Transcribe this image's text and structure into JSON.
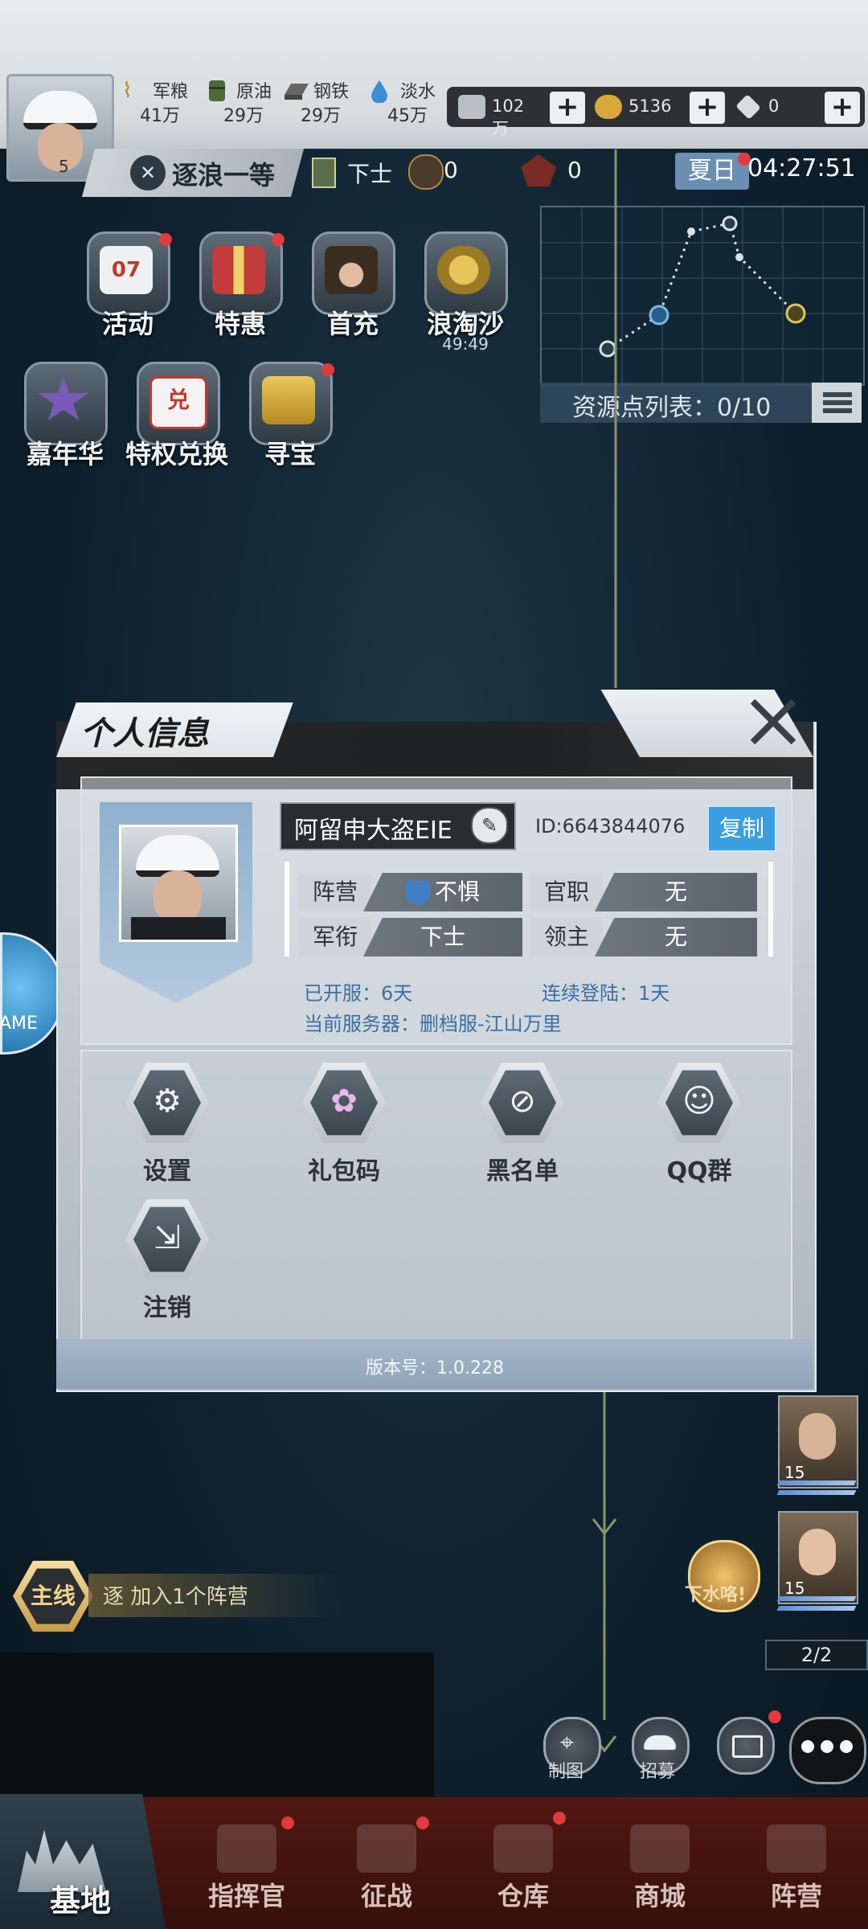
{
  "player": {
    "level": "5"
  },
  "resources": [
    {
      "name": "军粮",
      "value": "41万",
      "icon": "wheat-icon",
      "color": "#b08a2a"
    },
    {
      "name": "原油",
      "value": "29万",
      "icon": "oil-barrel-icon",
      "color": "#4c6a3a"
    },
    {
      "name": "钢铁",
      "value": "29万",
      "icon": "steel-ingot-icon",
      "color": "#555"
    },
    {
      "name": "淡水",
      "value": "45万",
      "icon": "water-drop-icon",
      "color": "#3a8ed4"
    }
  ],
  "currency": [
    {
      "value": "102万",
      "icon": "silver-bar-icon"
    },
    {
      "value": "5136",
      "icon": "gold-coin-icon"
    },
    {
      "value": "0",
      "icon": "diamond-icon"
    }
  ],
  "plus_label": "+",
  "rank": {
    "title": "逐浪一等",
    "military": "下士",
    "medals": "0",
    "honor": "0"
  },
  "season": "夏日",
  "timer": "04:27:51",
  "resource_list_label": "资源点列表：0/10",
  "events_row1": [
    {
      "label": "活动",
      "icon": "calendar-icon",
      "dot": true
    },
    {
      "label": "特惠",
      "icon": "gift-box-icon",
      "dot": true
    },
    {
      "label": "首充",
      "icon": "officer-portrait-icon",
      "dot": false
    },
    {
      "label": "浪淘沙",
      "icon": "coins-icon",
      "dot": false,
      "sub": "49:49"
    }
  ],
  "events_row2": [
    {
      "label": "嘉年华",
      "icon": "star-7-icon",
      "dot": false
    },
    {
      "label": "特权兑换",
      "icon": "exchange-icon",
      "dot": false
    },
    {
      "label": "寻宝",
      "icon": "treasure-icon",
      "dot": true
    }
  ],
  "modal": {
    "title": "个人信息",
    "name": "阿留申大盗EIE",
    "id": "ID:6643844076",
    "copy": "复制",
    "stats": {
      "camp_key": "阵营",
      "camp_val": "不惧",
      "office_key": "官职",
      "office_val": "无",
      "rank_key": "军衔",
      "rank_val": "下士",
      "lord_key": "领主",
      "lord_val": "无"
    },
    "server_days_label": "已开服：6天",
    "login_days_label": "连续登陆：1天",
    "server_name_label": "当前服务器：删档服-江山万里",
    "functions": [
      {
        "label": "设置",
        "icon": "gears-icon",
        "glyph": "⚙"
      },
      {
        "label": "礼包码",
        "icon": "gift-bag-icon",
        "glyph": "✿"
      },
      {
        "label": "黑名单",
        "icon": "block-user-icon",
        "glyph": "⊘"
      },
      {
        "label": "QQ群",
        "icon": "qq-penguin-icon",
        "glyph": "☺"
      },
      {
        "label": "注销",
        "icon": "logout-icon",
        "glyph": "⇲"
      }
    ],
    "version": "版本号：1.0.228"
  },
  "side_badge": "AME",
  "heroes": [
    {
      "level": "15"
    },
    {
      "level": "15"
    }
  ],
  "hero_page": "2/2",
  "quest": {
    "tag": "主线",
    "text": "逐 加入1个阵营"
  },
  "dive_label": "下水咯!",
  "bottom_actions": [
    {
      "label": "制图"
    },
    {
      "label": "招募"
    }
  ],
  "nav": [
    {
      "label": "基地",
      "icon": "city-skyline-icon",
      "active": true
    },
    {
      "label": "指挥官",
      "icon": "commander-icon",
      "dot": true
    },
    {
      "label": "征战",
      "icon": "warship-icon",
      "dot": true
    },
    {
      "label": "仓库",
      "icon": "warehouse-icon",
      "dot": true
    },
    {
      "label": "商城",
      "icon": "shop-icon"
    },
    {
      "label": "阵营",
      "icon": "camp-emblem-icon"
    }
  ]
}
